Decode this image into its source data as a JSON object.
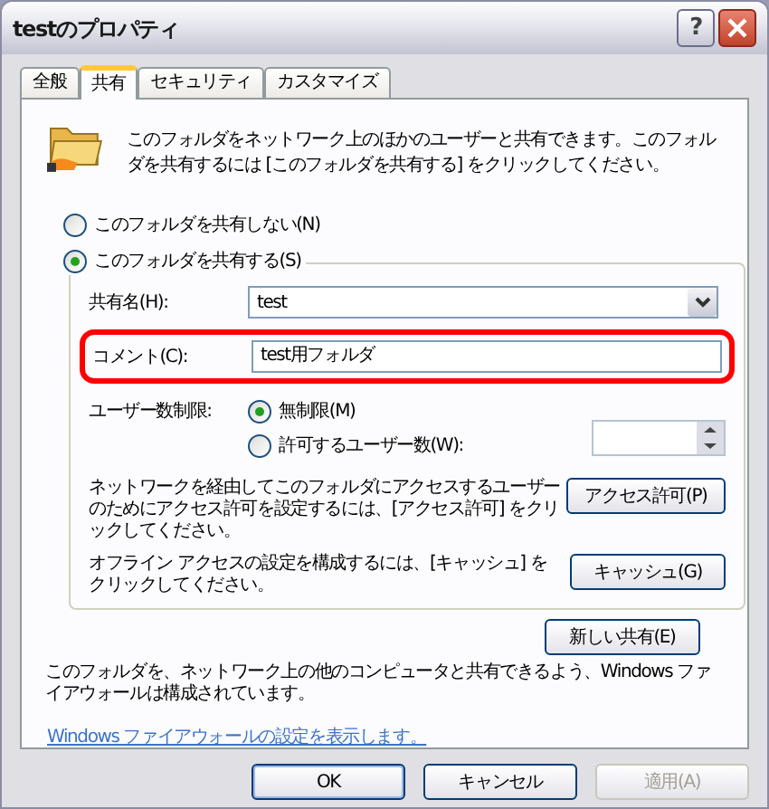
{
  "window": {
    "title": "testのプロパティ",
    "help_button": "?"
  },
  "tabs": [
    {
      "label": "全般",
      "selected": false
    },
    {
      "label": "共有",
      "selected": true
    },
    {
      "label": "セキュリティ",
      "selected": false
    },
    {
      "label": "カスタマイズ",
      "selected": false
    }
  ],
  "intro": "このフォルダをネットワーク上のほかのユーザーと共有できます。このフォルダを共有するには [このフォルダを共有する] をクリックしてください。",
  "share_options": [
    {
      "label": "このフォルダを共有しない(N)",
      "selected": false
    },
    {
      "label": "このフォルダを共有する(S)",
      "selected": true
    }
  ],
  "share_name": {
    "label": "共有名(H):",
    "value": "test"
  },
  "comment": {
    "label": "コメント(C):",
    "value": "test用フォルダ",
    "highlighted": true
  },
  "user_limit": {
    "label": "ユーザー数制限:",
    "options": [
      {
        "label": "無制限(M)",
        "selected": true
      },
      {
        "label": "許可するユーザー数(W):",
        "selected": false
      }
    ]
  },
  "permissions": {
    "text": "ネットワークを経由してこのフォルダにアクセスするユーザーのためにアクセス許可を設定するには、[アクセス許可] をクリックしてください。",
    "button": "アクセス許可(P)"
  },
  "caching": {
    "text": "オフライン アクセスの設定を構成するには、[キャッシュ] をクリックしてください。",
    "button": "キャッシュ(G)"
  },
  "new_share_button": "新しい共有(E)",
  "firewall_text": "このフォルダを、ネットワーク上の他のコンピュータと共有できるよう、Windows ファイアウォールは構成されています。",
  "firewall_link": "Windows ファイアウォールの設定を表示します。",
  "buttons": [
    {
      "label": "OK",
      "disabled": false,
      "default": true
    },
    {
      "label": "キャンセル",
      "disabled": false,
      "default": false
    },
    {
      "label": "適用(A)",
      "disabled": true,
      "default": false
    }
  ]
}
